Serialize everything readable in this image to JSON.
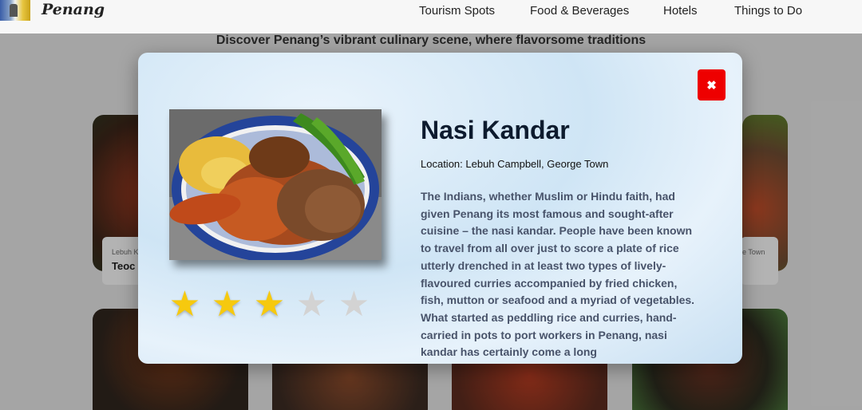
{
  "header": {
    "brand": "Penang",
    "nav": [
      "Tourism Spots",
      "Food & Beverages",
      "Hotels",
      "Things to Do"
    ]
  },
  "page": {
    "intro": "Discover Penang’s vibrant culinary scene, where flavorsome traditions",
    "cards": [
      {
        "location": "Lebuh K",
        "title": "Teoc"
      },
      {
        "location": "e Town",
        "title": ""
      }
    ]
  },
  "modal": {
    "close_label": "✖",
    "title": "Nasi Kandar",
    "location": "Location: Lebuh Campbell, George Town",
    "rating": 3,
    "rating_max": 5,
    "description": "The Indians, whether Muslim or Hindu faith, had given Penang its most famous and sought-after cuisine – the nasi kandar. People have been known to travel from all over just to score a plate of rice utterly drenched in at least two types of lively-flavoured curries accompanied by fried chicken, fish, mutton or seafood and a myriad of vegetables. What started as peddling rice and curries, hand-carried in pots to port workers in Penang, nasi kandar has certainly come a long",
    "colors": {
      "close": "#ee0000",
      "star_on": "#f6c90e",
      "star_off": "#d3d3d3"
    }
  }
}
